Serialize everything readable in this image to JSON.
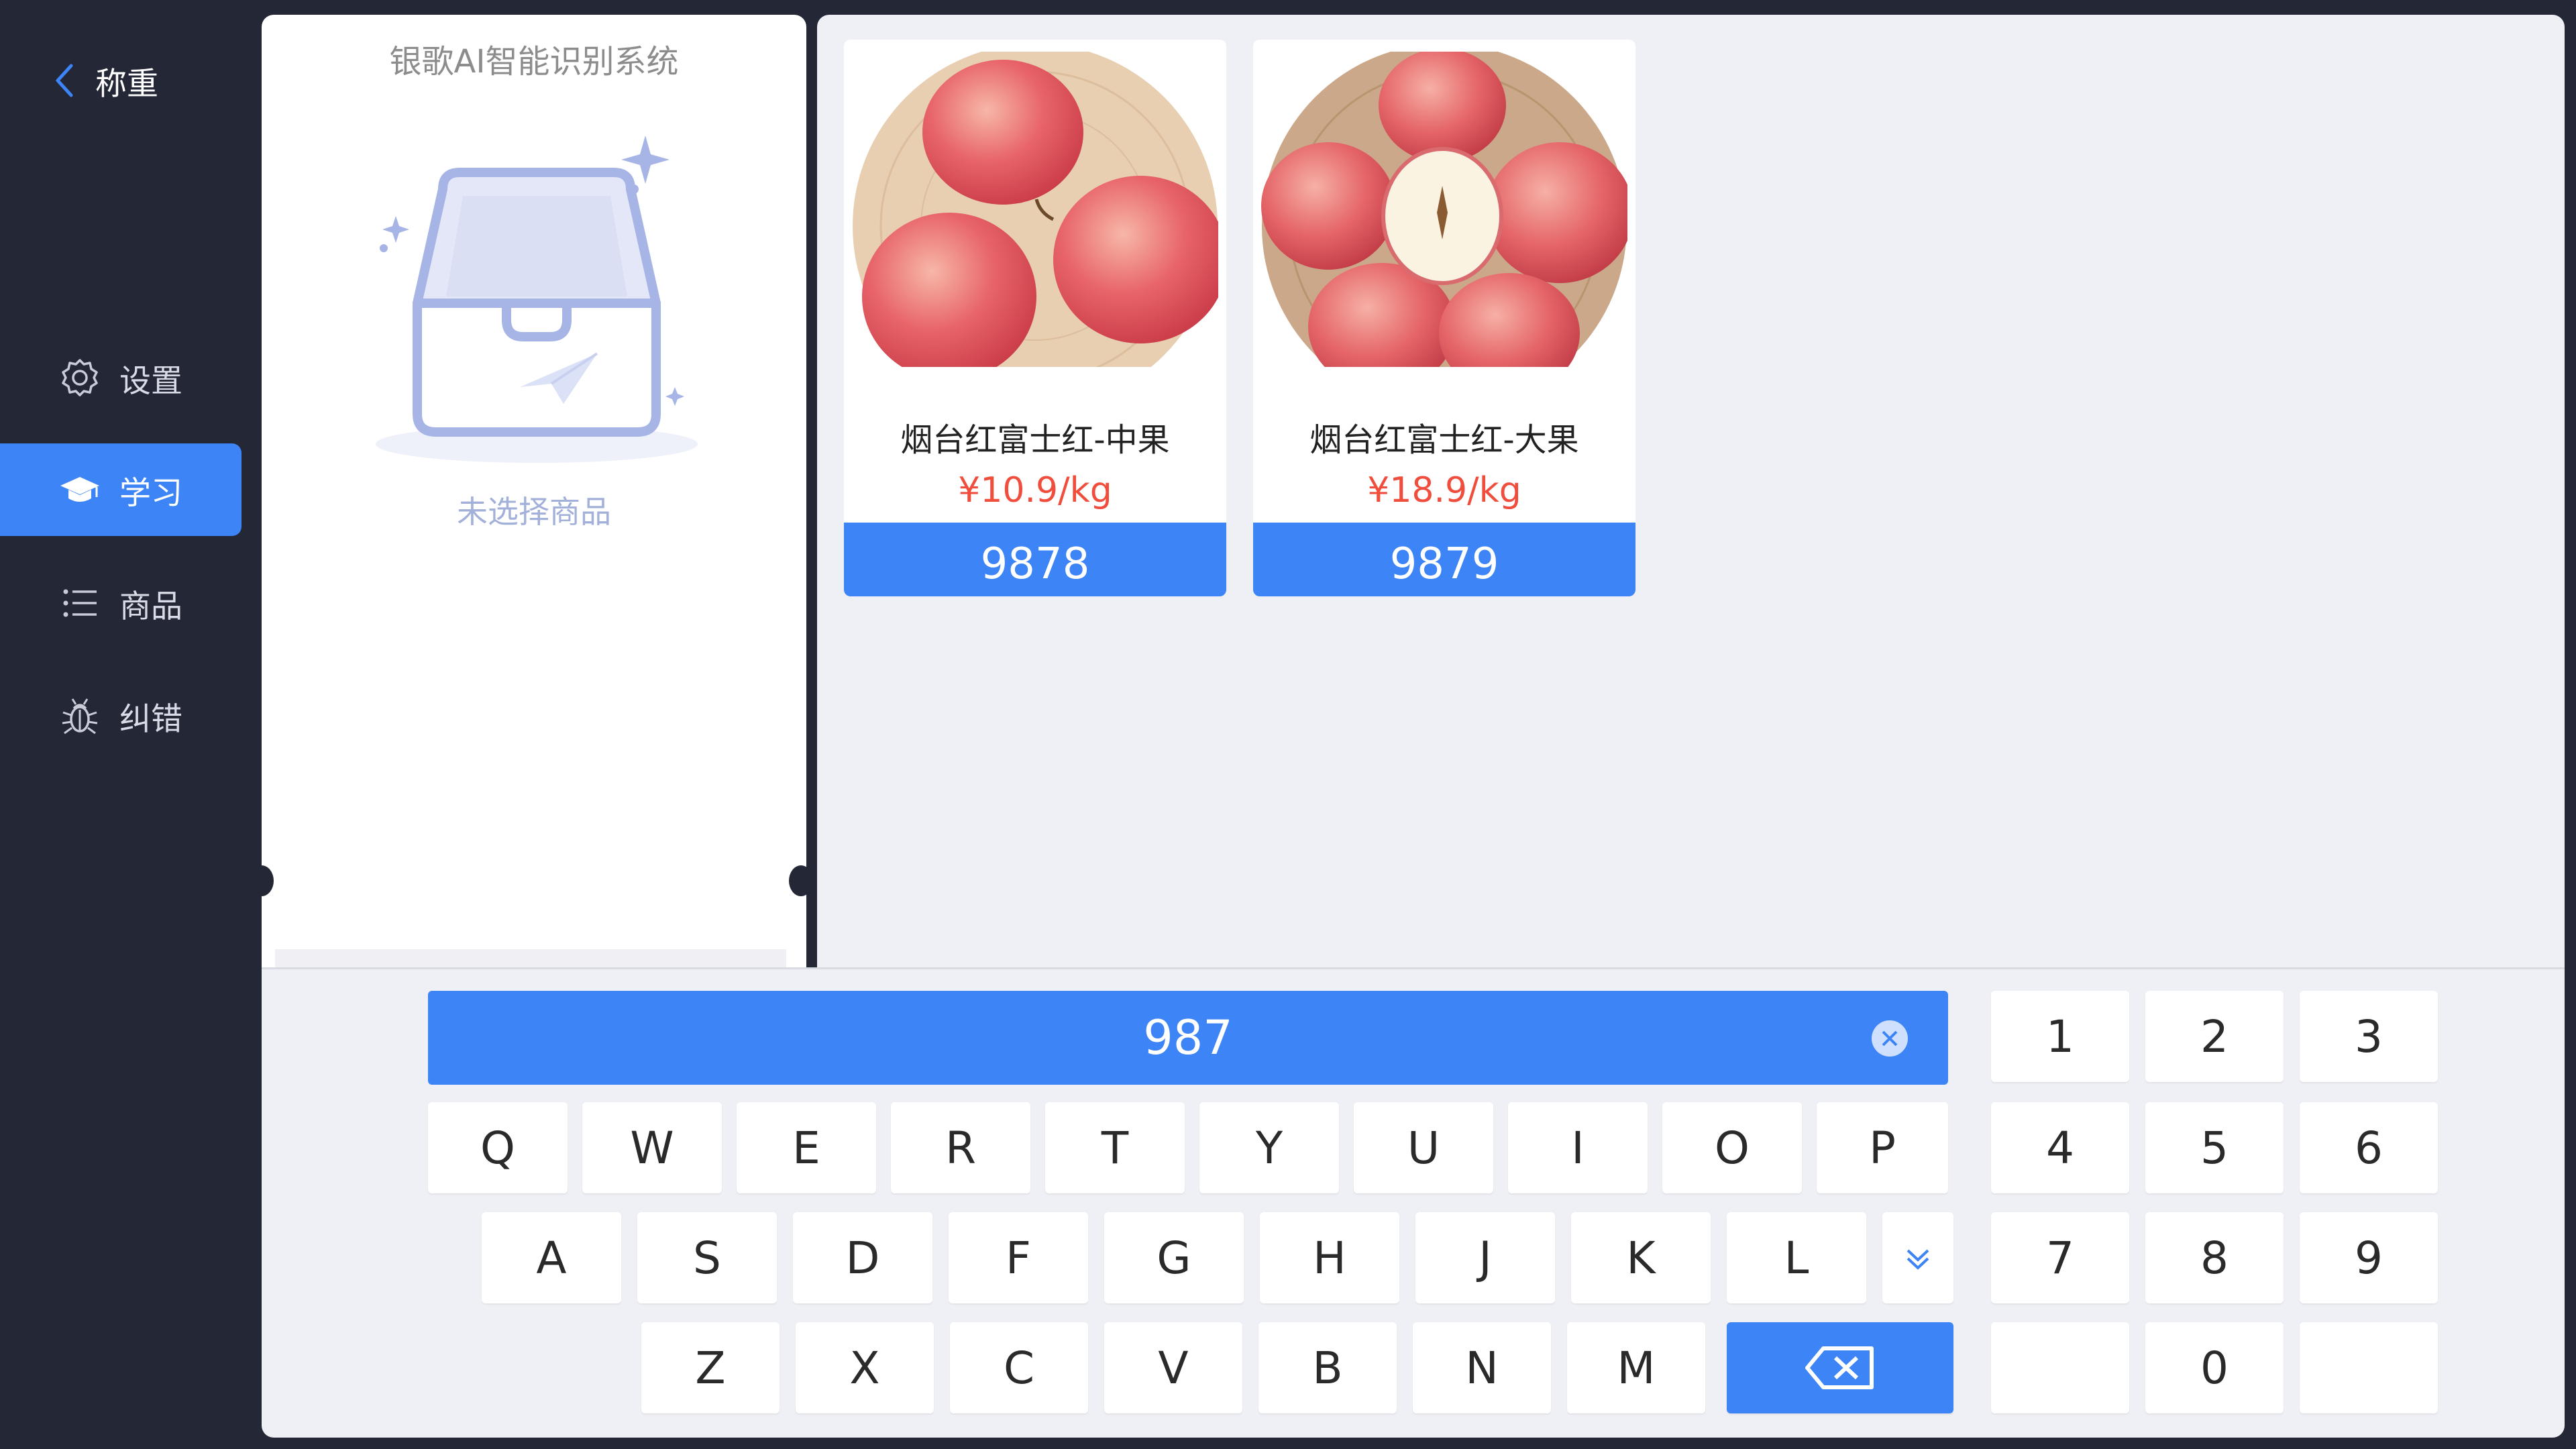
{
  "sidebar": {
    "back_label": "称重",
    "items": [
      {
        "label": "设置",
        "icon": "gear-icon"
      },
      {
        "label": "学习",
        "icon": "graduation-cap-icon",
        "active": true
      },
      {
        "label": "商品",
        "icon": "list-icon"
      },
      {
        "label": "纠错",
        "icon": "bug-icon"
      }
    ]
  },
  "left_panel": {
    "title": "银歌AI智能识别系统",
    "empty_text": "未选择商品"
  },
  "products": [
    {
      "name": "烟台红富士红-中果",
      "price": "¥10.9/kg",
      "code": "9878"
    },
    {
      "name": "烟台红富士红-大果",
      "price": "¥18.9/kg",
      "code": "9879"
    }
  ],
  "keyboard": {
    "input_value": "987",
    "row1": [
      "Q",
      "W",
      "E",
      "R",
      "T",
      "Y",
      "U",
      "I",
      "O",
      "P"
    ],
    "row2": [
      "A",
      "S",
      "D",
      "F",
      "G",
      "H",
      "J",
      "K",
      "L"
    ],
    "row3": [
      "Z",
      "X",
      "C",
      "V",
      "B",
      "N",
      "M"
    ],
    "numpad": [
      "1",
      "2",
      "3",
      "4",
      "5",
      "6",
      "7",
      "8",
      "9",
      "",
      "0",
      ""
    ]
  },
  "colors": {
    "accent": "#3d84f7",
    "sidebar_bg": "#232736",
    "price": "#f04d3c",
    "panel_bg": "#eff0f5"
  }
}
